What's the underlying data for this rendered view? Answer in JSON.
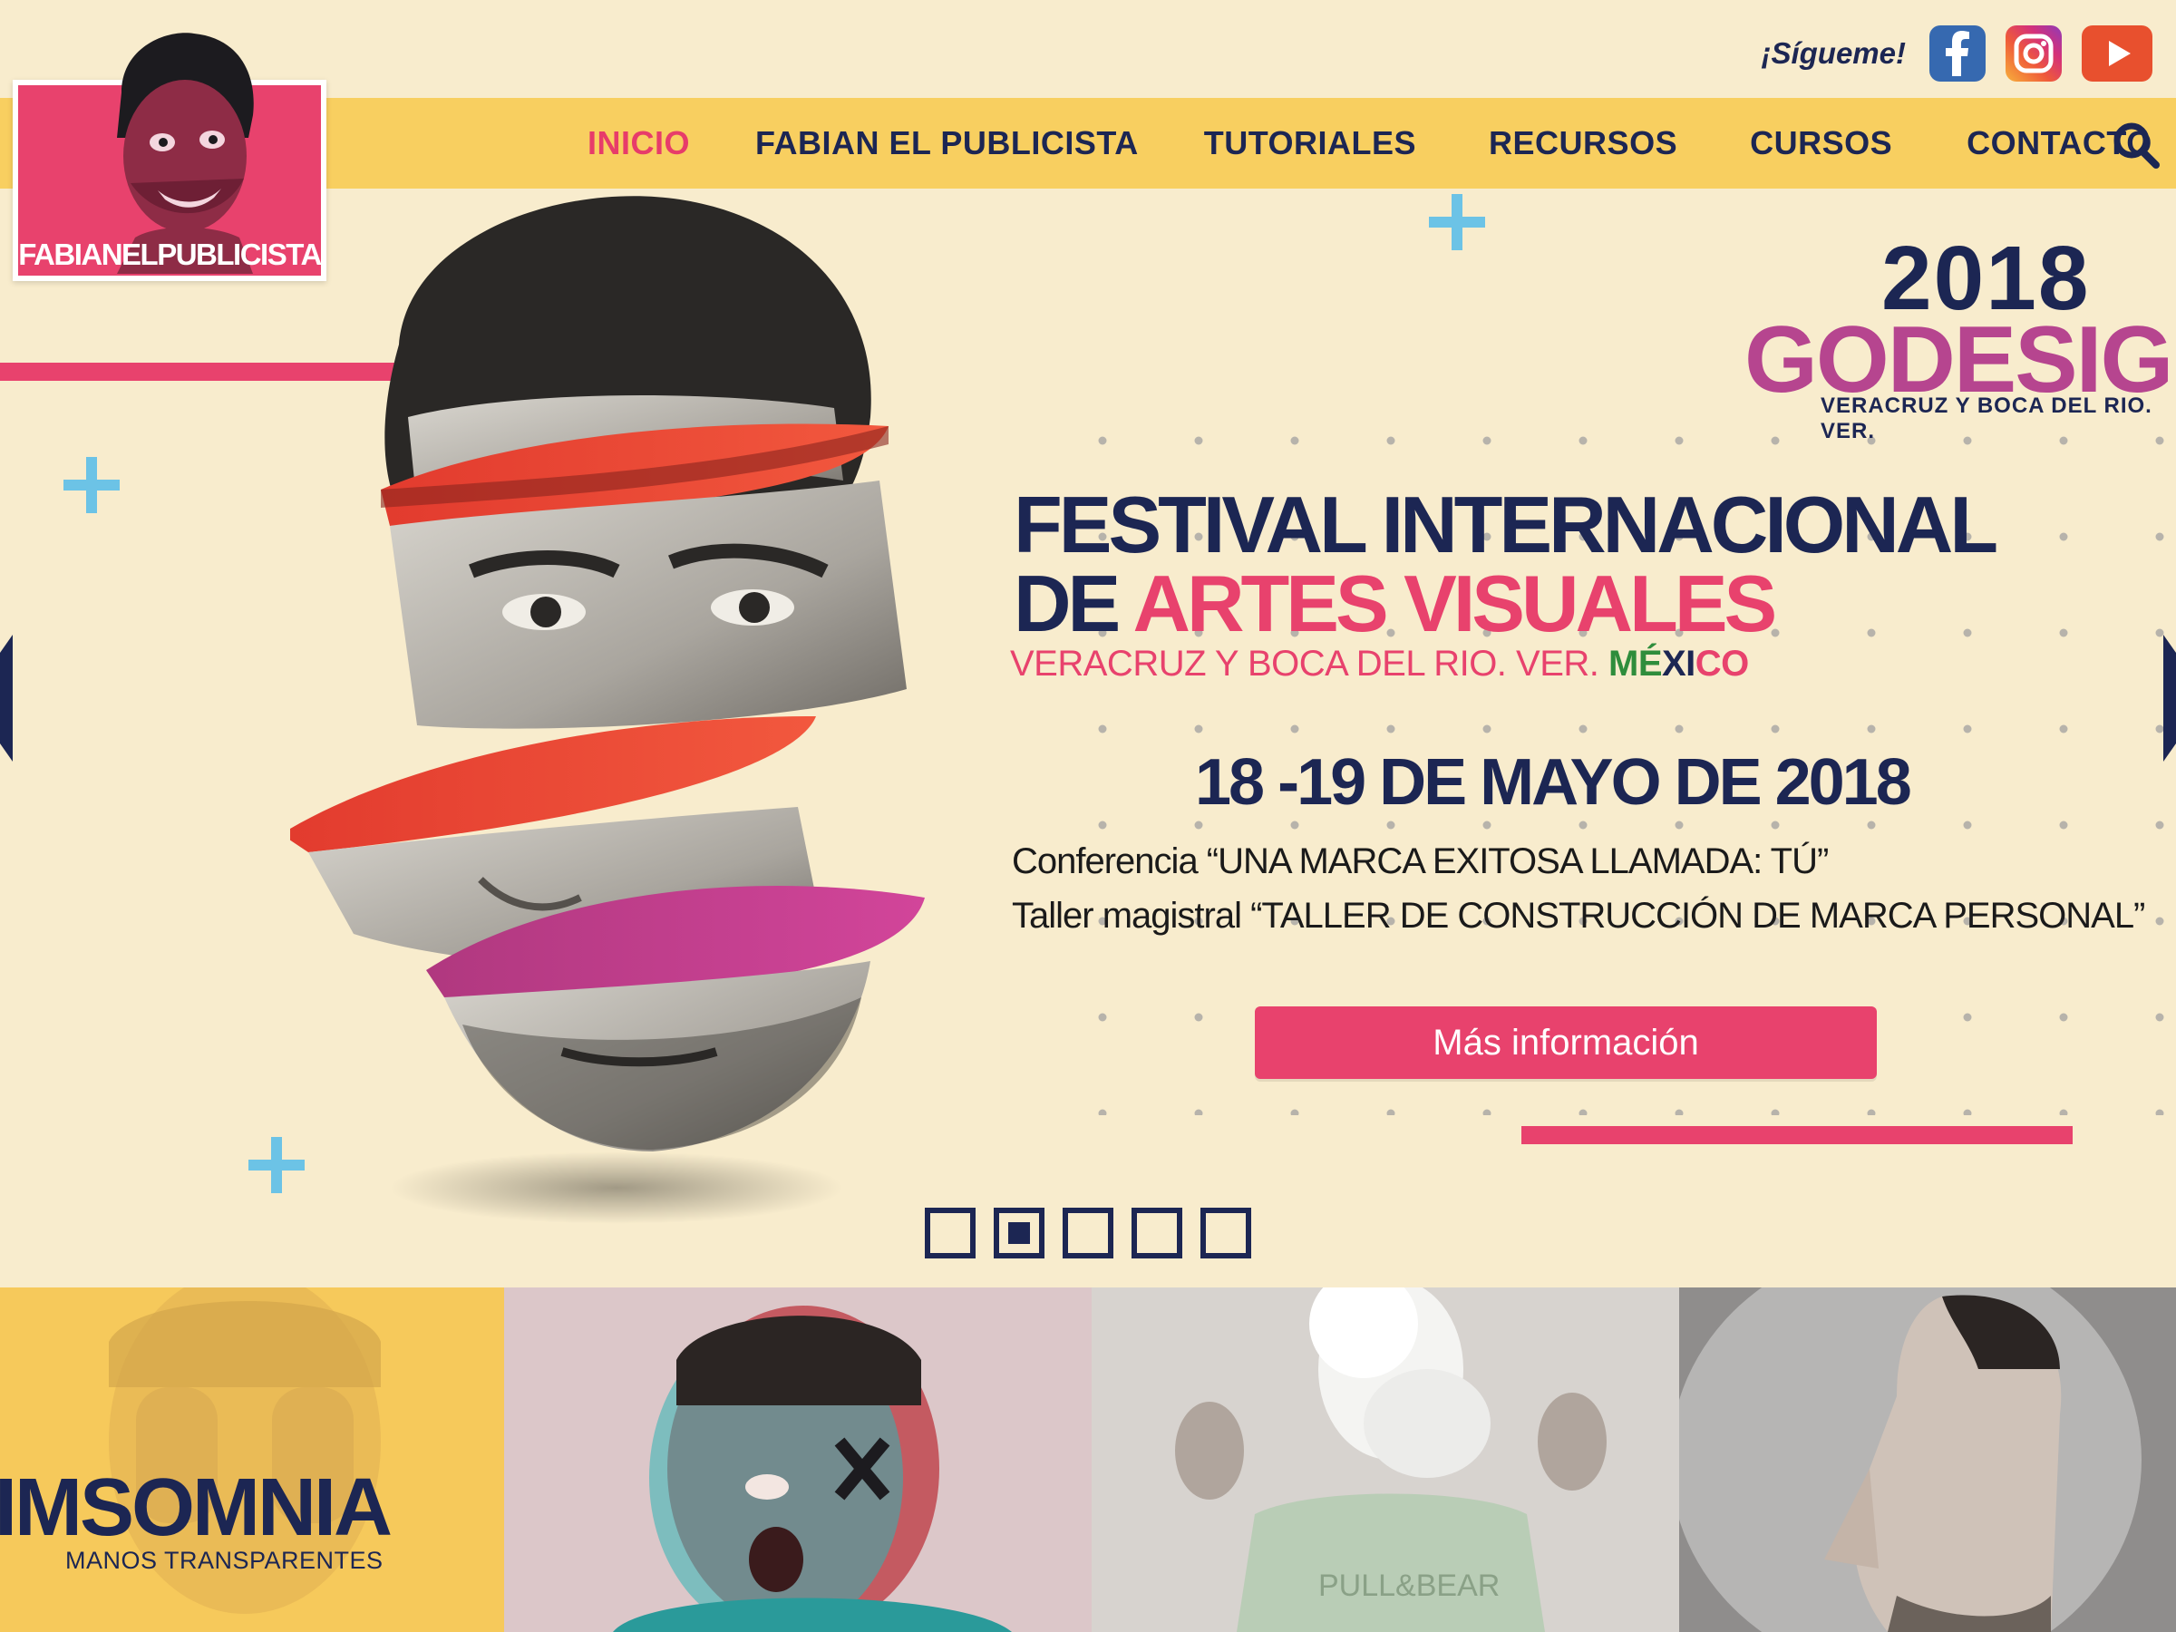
{
  "social": {
    "follow_label": "¡Sígueme!",
    "icons": [
      "facebook-icon",
      "instagram-icon",
      "youtube-icon"
    ]
  },
  "logo": {
    "text": "FABIANELPUBLICISTA"
  },
  "nav": {
    "items": [
      {
        "label": "INICIO",
        "active": true
      },
      {
        "label": "FABIAN EL PUBLICISTA",
        "active": false
      },
      {
        "label": "TUTORIALES",
        "active": false
      },
      {
        "label": "RECURSOS",
        "active": false
      },
      {
        "label": "CURSOS",
        "active": false
      },
      {
        "label": "CONTACTO",
        "active": false
      }
    ],
    "search_icon": "search-icon"
  },
  "hero": {
    "event_year": "2018",
    "event_brand": "GODESIGN",
    "event_location_small": "VERACRUZ Y BOCA DEL RIO. VER.",
    "festival_line1": "FESTIVAL INTERNACIONAL",
    "festival_line2_prefix": "DE ",
    "festival_line2_accent": "ARTES VISUALES",
    "location_text": "VERACRUZ Y BOCA DEL RIO. VER. ",
    "country_g": "MÉ",
    "country_w": "XI",
    "country_r": "CO",
    "date": "18 -19  DE MAYO DE 2018",
    "conference": "Conferencia “UNA MARCA EXITOSA LLAMADA: TÚ”",
    "workshop": "Taller magistral “TALLER DE CONSTRUCCIÓN DE MARCA PERSONAL”",
    "cta_label": "Más información",
    "slides_count": 5,
    "active_slide": 2
  },
  "gallery": {
    "tile1_title": "IMSOMNIA",
    "tile1_subtitle": "MANOS TRANSPARENTES"
  },
  "colors": {
    "background": "#f8eccd",
    "navbar": "#f8cf60",
    "navy": "#1c2653",
    "pink": "#e8426d",
    "purple": "#b6458f",
    "light_blue": "#6cc3e6"
  }
}
